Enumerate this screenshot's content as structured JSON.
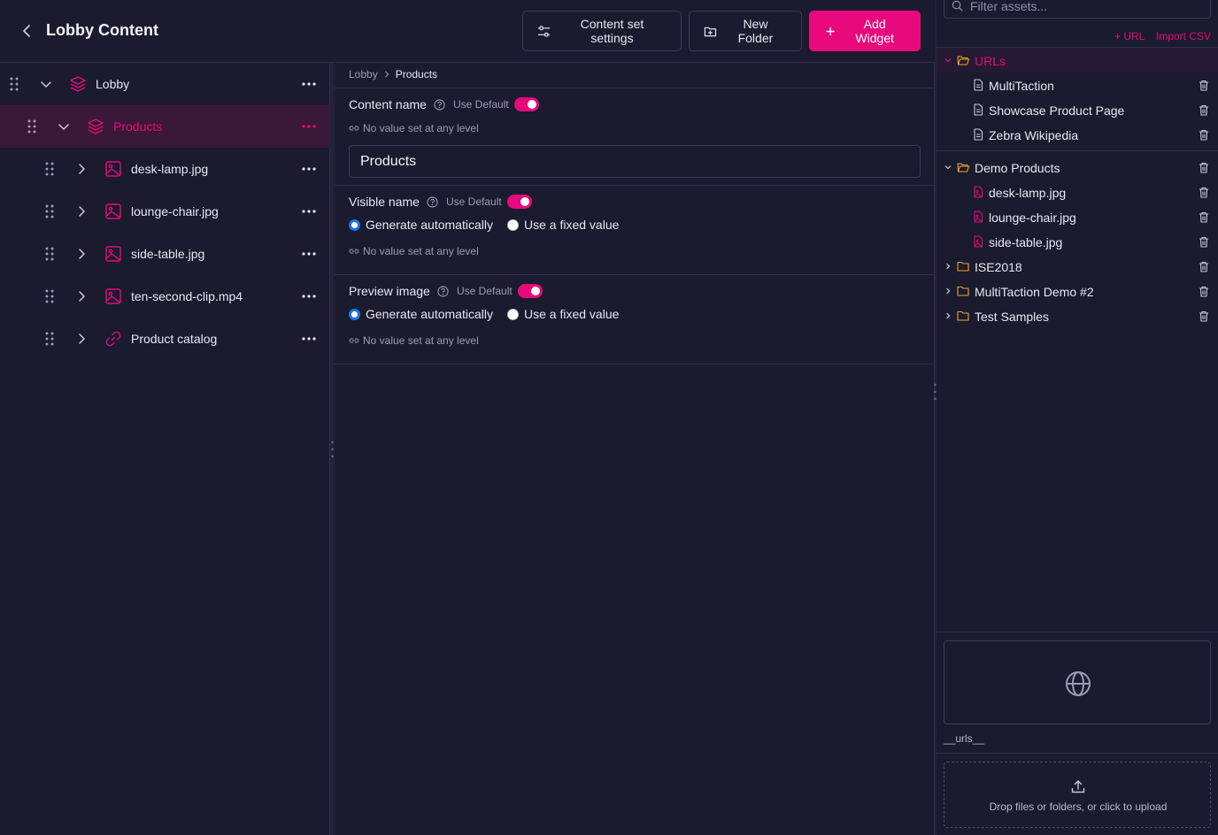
{
  "header": {
    "title": "Lobby Content",
    "buttons": {
      "content_settings": "Content set settings",
      "new_folder": "New Folder",
      "add_widget": "Add Widget"
    }
  },
  "tree": {
    "items": [
      {
        "label": "Lobby",
        "icon": "layers-icon"
      },
      {
        "label": "Products",
        "icon": "layers-icon",
        "selected": true
      },
      {
        "label": "desk-lamp.jpg",
        "icon": "image-icon"
      },
      {
        "label": "lounge-chair.jpg",
        "icon": "image-icon"
      },
      {
        "label": "side-table.jpg",
        "icon": "image-icon"
      },
      {
        "label": "ten-second-clip.mp4",
        "icon": "image-icon"
      },
      {
        "label": "Product catalog",
        "icon": "link-icon"
      }
    ]
  },
  "breadcrumb": {
    "root": "Lobby",
    "current": "Products"
  },
  "form": {
    "content_name": {
      "label": "Content name",
      "use_default": "Use Default",
      "no_value": "No value set at any level",
      "value": "Products"
    },
    "visible_name": {
      "label": "Visible name",
      "use_default": "Use Default",
      "option_auto": "Generate automatically",
      "option_fixed": "Use a fixed value",
      "no_value": "No value set at any level"
    },
    "preview_image": {
      "label": "Preview image",
      "use_default": "Use Default",
      "option_auto": "Generate automatically",
      "option_fixed": "Use a fixed value",
      "no_value": "No value set at any level"
    }
  },
  "assets": {
    "filter_placeholder": "Filter assets...",
    "add_url": "+ URL",
    "import_csv": "Import CSV",
    "items": [
      {
        "label": "URLs",
        "type": "folder-open",
        "highlight": true
      },
      {
        "label": "MultiTaction",
        "type": "document"
      },
      {
        "label": "Showcase Product Page",
        "type": "document"
      },
      {
        "label": "Zebra Wikipedia",
        "type": "document"
      },
      {
        "label": "Demo Products",
        "type": "folder-open"
      },
      {
        "label": "desk-lamp.jpg",
        "type": "image-file"
      },
      {
        "label": "lounge-chair.jpg",
        "type": "image-file"
      },
      {
        "label": "side-table.jpg",
        "type": "image-file"
      },
      {
        "label": "ISE2018",
        "type": "folder"
      },
      {
        "label": "MultiTaction Demo #2",
        "type": "folder"
      },
      {
        "label": "Test Samples",
        "type": "folder"
      }
    ],
    "preview_name": "__urls__",
    "drop_text": "Drop files or folders, or click to upload"
  },
  "colors": {
    "accent": "#e8097c",
    "background": "#1a1b2e",
    "folder": "#f5a623",
    "radio": "#1a73e8"
  }
}
